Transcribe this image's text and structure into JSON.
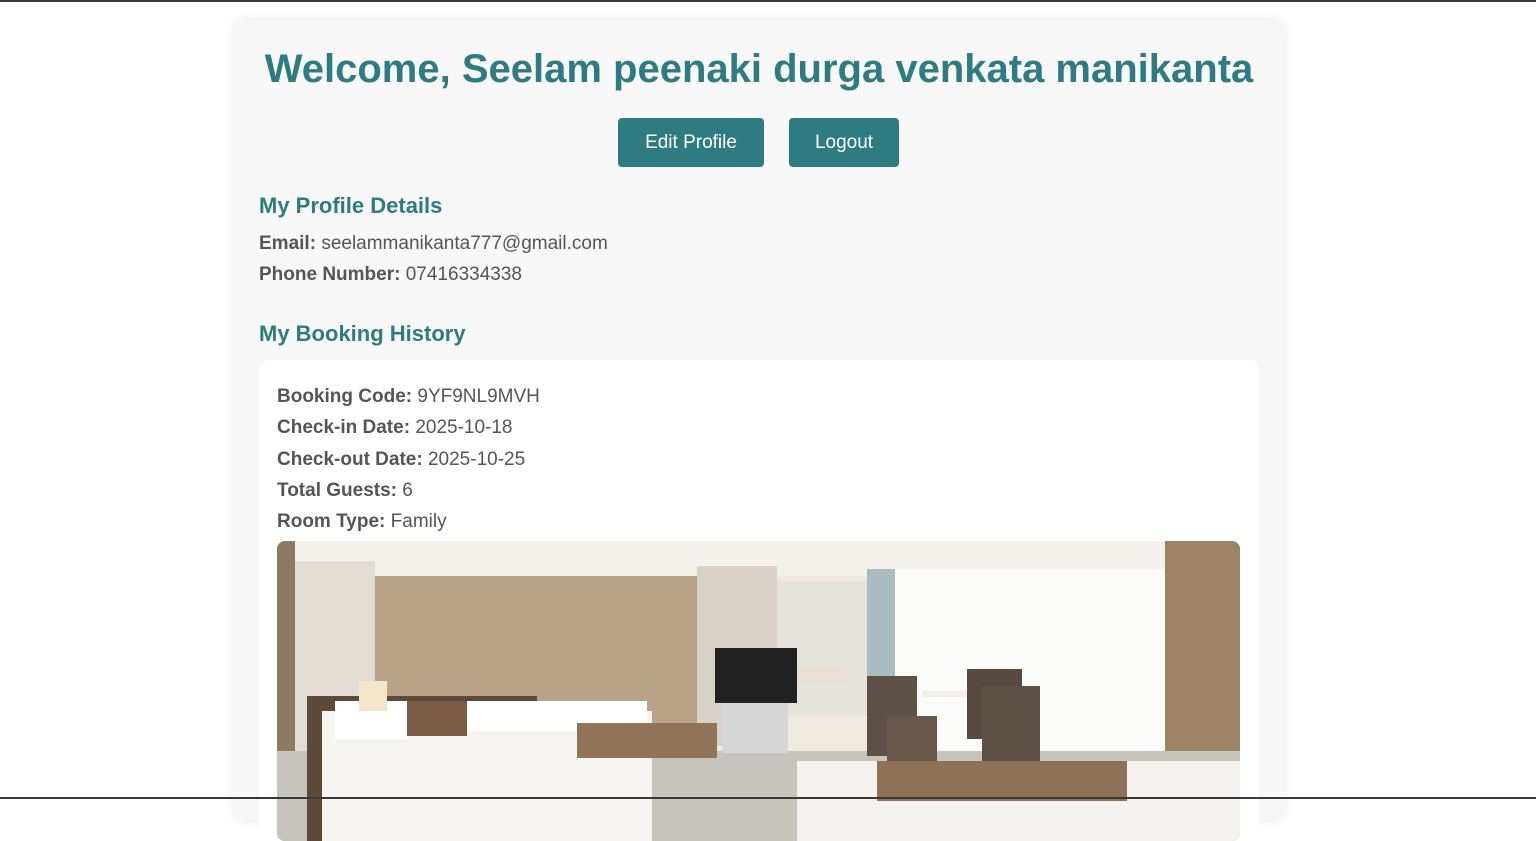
{
  "header": {
    "welcome": "Welcome, Seelam peenaki durga venkata manikanta"
  },
  "actions": {
    "edit_profile_label": "Edit Profile",
    "logout_label": "Logout"
  },
  "profile": {
    "title": "My Profile Details",
    "email_label": "Email:",
    "email_value": "seelammanikanta777@gmail.com",
    "phone_label": "Phone Number:",
    "phone_value": "07416334338"
  },
  "history": {
    "title": "My Booking History",
    "bookings": [
      {
        "code_label": "Booking Code:",
        "code": "9YF9NL9MVH",
        "checkin_label": "Check-in Date:",
        "checkin": "2025-10-18",
        "checkout_label": "Check-out Date:",
        "checkout": "2025-10-25",
        "guests_label": "Total Guests:",
        "guests": "6",
        "room_label": "Room Type:",
        "room_type": "Family"
      }
    ]
  },
  "colors": {
    "accent": "#2e7c82",
    "text": "#555555",
    "panel": "#f8f8f8"
  }
}
